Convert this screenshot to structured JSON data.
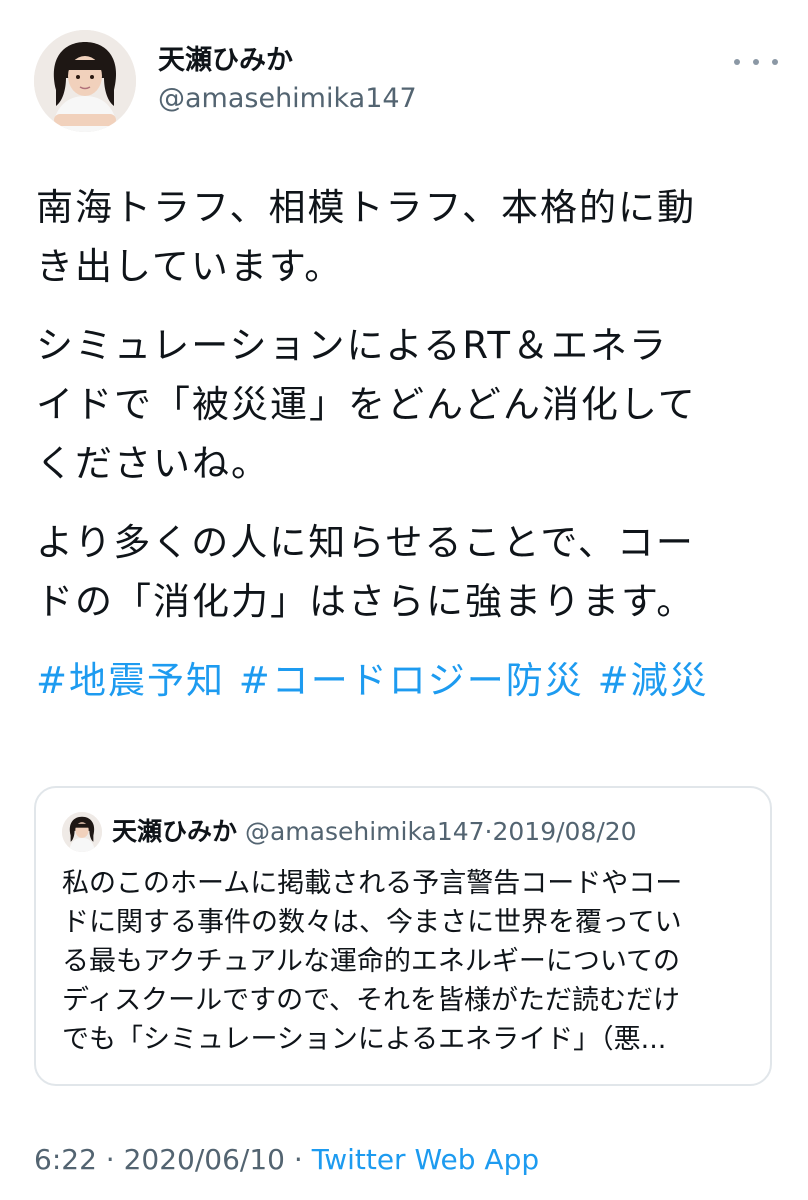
{
  "author": {
    "name": "天瀬ひみか",
    "handle": "@amasehimika147"
  },
  "tweet": {
    "paragraphs": [
      {
        "lines": [
          "南海トラフ、相模トラフ、本格的に動",
          "き出しています。"
        ]
      },
      {
        "lines": [
          "シミュレーションによるRT＆エネラ",
          "イドで「被災運」をどんどん消化して",
          "くださいね。"
        ]
      },
      {
        "lines": [
          "より多くの人に知らせることで、コー",
          "ドの「消化力」はさらに強まります。"
        ]
      }
    ],
    "hashtags": [
      "#地震予知",
      "#コードロジー防災",
      "#減災"
    ]
  },
  "quote": {
    "name": "天瀬ひみか",
    "handle": "@amasehimika147",
    "separator": "·",
    "date": "2019/08/20",
    "lines": [
      "私のこのホームに掲載される予言警告コードやコー",
      "ドに関する事件の数々は、今まさに世界を覆ってい",
      "る最もアクチュアルな運命的エネルギーについての",
      "ディスクールですので、それを皆様がただ読むだけ",
      "でも「シミュレーションによるエネライド」（悪..."
    ]
  },
  "footer": {
    "time": "6:22",
    "sep1": "·",
    "date": "2020/06/10",
    "sep2": "·",
    "source": "Twitter Web App"
  },
  "icons": {
    "more": "more-icon",
    "avatar": "avatar-icon"
  },
  "colors": {
    "accent": "#1d9bf0",
    "secondary_text": "#536471",
    "border": "#e1e6ea"
  }
}
